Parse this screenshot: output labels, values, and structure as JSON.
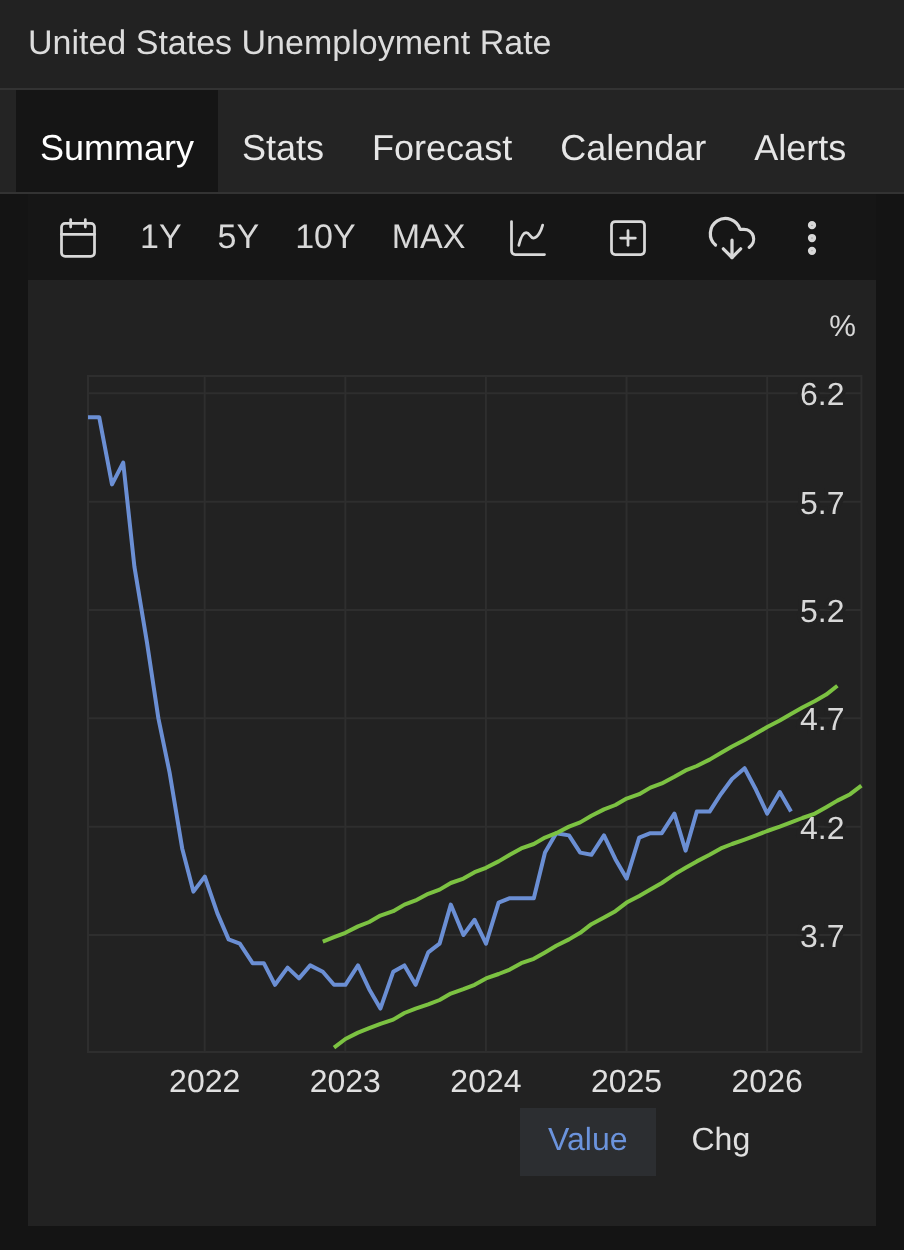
{
  "title": "United States Unemployment Rate",
  "tabs": [
    {
      "label": "Summary",
      "selected": true
    },
    {
      "label": "Stats",
      "selected": false
    },
    {
      "label": "Forecast",
      "selected": false
    },
    {
      "label": "Calendar",
      "selected": false
    },
    {
      "label": "Alerts",
      "selected": false
    }
  ],
  "toolbar": {
    "ranges": [
      {
        "label": "1Y",
        "selected": false
      },
      {
        "label": "5Y",
        "selected": false
      },
      {
        "label": "10Y",
        "selected": false
      },
      {
        "label": "MAX",
        "selected": false
      }
    ]
  },
  "chart": {
    "unit": "%",
    "chart_data": {
      "type": "line",
      "grid": true,
      "xlim": [
        2021.17,
        2026.67
      ],
      "ylim": [
        3.16,
        6.28
      ],
      "xticks": [
        2022,
        2023,
        2024,
        2025,
        2026
      ],
      "yticks": [
        6.2,
        5.7,
        5.2,
        4.7,
        4.2,
        3.7
      ],
      "x": [
        2021.17,
        2021.25,
        2021.34,
        2021.42,
        2021.5,
        2021.59,
        2021.67,
        2021.75,
        2021.84,
        2021.92,
        2022.0,
        2022.09,
        2022.17,
        2022.25,
        2022.34,
        2022.42,
        2022.5,
        2022.59,
        2022.67,
        2022.75,
        2022.84,
        2022.92,
        2023.0,
        2023.09,
        2023.17,
        2023.25,
        2023.34,
        2023.42,
        2023.5,
        2023.59,
        2023.67,
        2023.75,
        2023.84,
        2023.92,
        2024.0,
        2024.09,
        2024.17,
        2024.25,
        2024.34,
        2024.42,
        2024.5,
        2024.59,
        2024.67,
        2024.75,
        2024.84,
        2024.92,
        2025.0,
        2025.09,
        2025.17,
        2025.25,
        2025.34,
        2025.42,
        2025.5,
        2025.59,
        2025.67,
        2025.75,
        2025.84,
        2025.92,
        2026.0,
        2026.09,
        2026.17,
        2026.25,
        2026.34,
        2026.42,
        2026.5,
        2026.59,
        2026.67
      ],
      "series": [
        {
          "color": "#6b8fd4",
          "values": [
            6.09,
            6.09,
            5.78,
            5.88,
            5.4,
            5.05,
            4.7,
            4.45,
            4.1,
            3.9,
            3.97,
            3.8,
            3.68,
            3.66,
            3.57,
            3.57,
            3.47,
            3.55,
            3.5,
            3.56,
            3.53,
            3.47,
            3.47,
            3.56,
            3.45,
            3.36,
            3.53,
            3.56,
            3.47,
            3.62,
            3.66,
            3.84,
            3.7,
            3.77,
            3.66,
            3.85,
            3.87,
            3.87,
            3.87,
            4.08,
            4.17,
            4.16,
            4.08,
            4.07,
            4.16,
            4.05,
            3.96,
            4.15,
            4.17,
            4.17,
            4.26,
            4.09,
            4.27,
            4.27,
            4.35,
            4.42,
            4.47,
            4.37,
            4.26,
            4.36,
            4.27,
            null,
            null,
            null,
            null,
            null,
            null
          ]
        },
        {
          "color": "#7cc242",
          "values": [
            null,
            null,
            null,
            null,
            null,
            null,
            null,
            null,
            null,
            null,
            null,
            null,
            null,
            null,
            null,
            null,
            null,
            null,
            null,
            null,
            3.67,
            3.69,
            3.71,
            3.74,
            3.76,
            3.79,
            3.81,
            3.84,
            3.86,
            3.89,
            3.91,
            3.94,
            3.96,
            3.99,
            4.01,
            4.04,
            4.07,
            4.1,
            4.12,
            4.15,
            4.17,
            4.2,
            4.22,
            4.25,
            4.28,
            4.3,
            4.33,
            4.35,
            4.38,
            4.4,
            4.43,
            4.46,
            4.48,
            4.51,
            4.54,
            4.57,
            4.6,
            4.63,
            4.66,
            4.69,
            4.72,
            4.75,
            4.78,
            4.81,
            4.85,
            null,
            null
          ]
        },
        {
          "color": "#7cc242",
          "values": [
            null,
            null,
            null,
            null,
            null,
            null,
            null,
            null,
            null,
            null,
            null,
            null,
            null,
            null,
            null,
            null,
            null,
            null,
            null,
            null,
            null,
            3.18,
            3.22,
            3.25,
            3.27,
            3.29,
            3.31,
            3.34,
            3.36,
            3.38,
            3.4,
            3.43,
            3.45,
            3.47,
            3.5,
            3.52,
            3.54,
            3.57,
            3.59,
            3.62,
            3.65,
            3.68,
            3.71,
            3.75,
            3.78,
            3.81,
            3.85,
            3.88,
            3.91,
            3.94,
            3.98,
            4.01,
            4.04,
            4.07,
            4.1,
            4.12,
            4.14,
            4.16,
            4.18,
            4.2,
            4.22,
            4.24,
            4.26,
            4.29,
            4.32,
            4.35,
            4.39
          ]
        }
      ]
    }
  },
  "view_toggle": [
    {
      "label": "Value",
      "selected": true
    },
    {
      "label": "Chg",
      "selected": false
    }
  ]
}
